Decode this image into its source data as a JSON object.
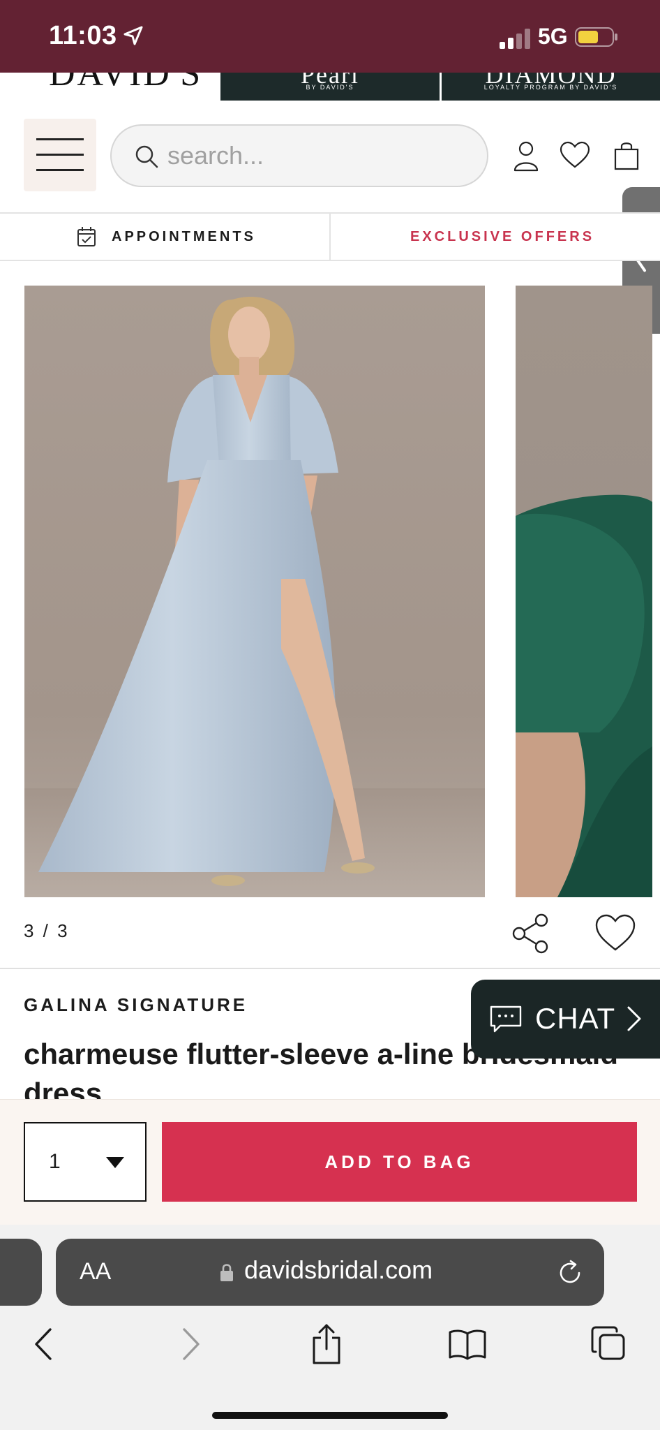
{
  "status_bar": {
    "time": "11:03",
    "network": "5G"
  },
  "brand_strip": {
    "davids": "DAVID'S",
    "pearl": "Pearl",
    "pearl_sub": "BY DAVID'S",
    "diamond": "DIAMOND",
    "diamond_sub": "LOYALTY PROGRAM BY DAVID'S"
  },
  "header": {
    "search_placeholder": "search..."
  },
  "subnav": {
    "appointments": "APPOINTMENTS",
    "offers": "EXCLUSIVE OFFERS"
  },
  "gallery": {
    "counter": "3 / 3"
  },
  "product": {
    "brand": "GALINA SIGNATURE",
    "title": "charmeuse flutter-sleeve a-line bridesmaid dress"
  },
  "chat": {
    "label": "CHAT"
  },
  "purchase": {
    "quantity": "1",
    "add_label": "ADD TO BAG"
  },
  "browser": {
    "aa": "AA",
    "url": "davidsbridal.com"
  },
  "colors": {
    "status_bar": "#632233",
    "accent_red": "#d63150",
    "offers_red": "#c8334e",
    "chat_bg": "#1b2626",
    "dress_blue": "#b9c7d6",
    "dress_green": "#1d5a48"
  }
}
